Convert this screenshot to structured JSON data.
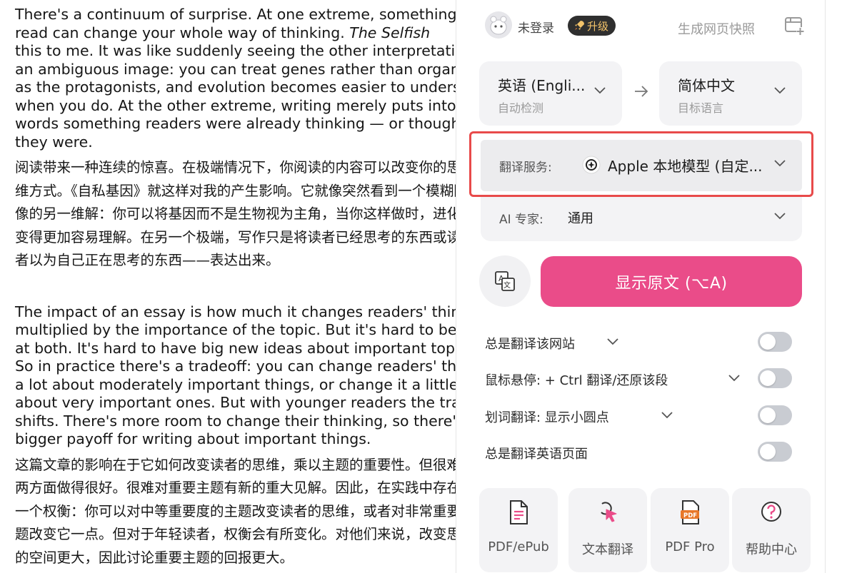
{
  "article": {
    "en1": [
      "There's a continuum of surprise. At one extreme, something you",
      "read can change your whole way of thinking. ",
      "this to me. It was like suddenly seeing the other interpretation of",
      "an ambiguous image: you can treat genes rather than organisms",
      "as the protagonists, and evolution becomes easier to understand",
      "when you do. At the other extreme, writing merely puts into",
      "words something readers were already thinking — or thought",
      "they were."
    ],
    "en1_italic": "The Selfish",
    "zh1": [
      "阅读带来一种连续的惊喜。在极端情况下，你阅读的内容可以改变你的思",
      "维方式。《自私基因》就这样对我的产生影响。它就像突然看到一个模糊图",
      "像的另一维解：你可以将基因而不是生物视为主角，当你这样做时，进化",
      "变得更加容易理解。在另一个极端，写作只是将读者已经思考的东西或读",
      "者以为自己正在思考的东西——表达出来。"
    ],
    "en2": [
      "The impact of an essay is how much it changes readers' thinking",
      "multiplied by the importance of the topic. But it's hard to be good",
      "at both. It's hard to have big new ideas about important topics.",
      "So in practice there's a tradeoff: you can change readers' thinking",
      "a lot about moderately important things, or change it a little",
      "about very important ones. But with younger readers the tradeoff",
      "shifts. There's more room to change their thinking, so there's a",
      "bigger payoff for writing about important things."
    ],
    "zh2": [
      "这篇文章的影响在于它如何改变读者的思维，乘以主题的重要性。但很难在",
      "两方面做得很好。很难对重要主题有新的重大见解。因此，在实践中存在",
      "一个权衡：你可以对中等重要度的主题改变读者的思维，或者对非常重要的主",
      "题改变它一点。但对于年轻读者，权衡会有所变化。对他们来说，改变思维",
      "的空间更大，因此讨论重要主题的回报更大。"
    ]
  },
  "panel": {
    "user": {
      "login_text": "未登录",
      "upgrade_label": "升级",
      "snapshot_label": "生成网页快照"
    },
    "source_lang": {
      "name": "英语 (Engli...",
      "sub": "自动检测"
    },
    "target_lang": {
      "name": "简体中文",
      "sub": "目标语言"
    },
    "service": {
      "label": "翻译服务:",
      "value": "Apple 本地模型 (自定..."
    },
    "expert": {
      "label": "AI 专家:",
      "value": "通用"
    },
    "show_original_label": "显示原文 (⌥A)",
    "options": [
      {
        "label": "总是翻译该网站",
        "has_dropdown": true,
        "enabled": false
      },
      {
        "label": "鼠标悬停:  + Ctrl 翻译/还原该段",
        "has_dropdown": true,
        "enabled": false
      },
      {
        "label": "划词翻译:  显示小圆点",
        "has_dropdown": true,
        "enabled": false
      },
      {
        "label": "总是翻译英语页面",
        "has_dropdown": false,
        "enabled": false
      }
    ],
    "tools": [
      {
        "label": "PDF/ePub",
        "icon": "document-icon"
      },
      {
        "label": "文本翻译",
        "icon": "cursor-click-icon"
      },
      {
        "label": "PDF Pro",
        "icon": "pdf-icon"
      },
      {
        "label": "帮助中心",
        "icon": "help-icon"
      }
    ]
  },
  "colors": {
    "accent": "#ea4c89",
    "highlight_outline": "#e84a4a",
    "toggle_off": "#c9ccd2"
  }
}
